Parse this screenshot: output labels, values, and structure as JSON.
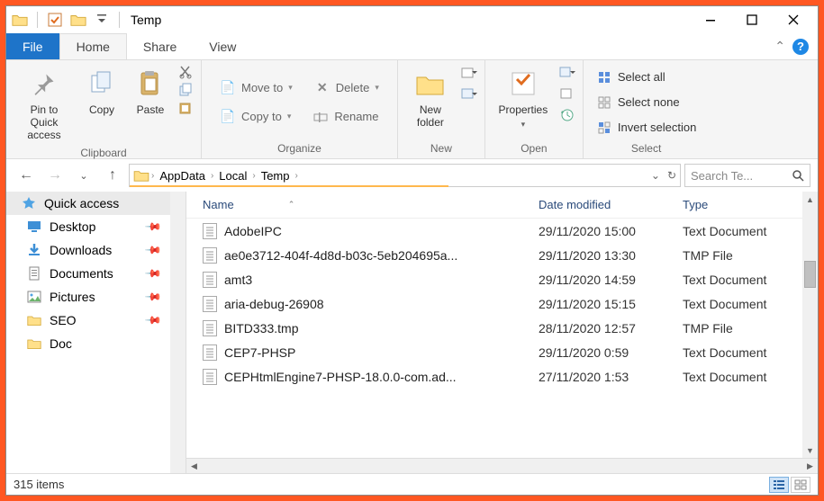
{
  "window": {
    "title": "Temp"
  },
  "tabs": {
    "file": "File",
    "home": "Home",
    "share": "Share",
    "view": "View"
  },
  "ribbon": {
    "clipboard": {
      "label": "Clipboard",
      "pin": "Pin to Quick access",
      "copy": "Copy",
      "paste": "Paste"
    },
    "organize": {
      "label": "Organize",
      "move_to": "Move to",
      "copy_to": "Copy to",
      "delete": "Delete",
      "rename": "Rename"
    },
    "new": {
      "label": "New",
      "new_folder": "New folder"
    },
    "open": {
      "label": "Open",
      "properties": "Properties"
    },
    "select": {
      "label": "Select",
      "select_all": "Select all",
      "select_none": "Select none",
      "invert": "Invert selection"
    }
  },
  "breadcrumb": {
    "items": [
      "AppData",
      "Local",
      "Temp"
    ]
  },
  "search": {
    "placeholder": "Search Te..."
  },
  "sidebar": {
    "header": "Quick access",
    "items": [
      {
        "label": "Desktop",
        "pinned": true
      },
      {
        "label": "Downloads",
        "pinned": true
      },
      {
        "label": "Documents",
        "pinned": true
      },
      {
        "label": "Pictures",
        "pinned": true
      },
      {
        "label": "SEO",
        "pinned": true
      },
      {
        "label": "Doc",
        "pinned": false
      }
    ]
  },
  "columns": {
    "name": "Name",
    "date": "Date modified",
    "type": "Type"
  },
  "files": [
    {
      "name": "AdobeIPC",
      "date": "29/11/2020 15:00",
      "type": "Text Document"
    },
    {
      "name": "ae0e3712-404f-4d8d-b03c-5eb204695a...",
      "date": "29/11/2020 13:30",
      "type": "TMP File"
    },
    {
      "name": "amt3",
      "date": "29/11/2020 14:59",
      "type": "Text Document"
    },
    {
      "name": "aria-debug-26908",
      "date": "29/11/2020 15:15",
      "type": "Text Document"
    },
    {
      "name": "BITD333.tmp",
      "date": "28/11/2020 12:57",
      "type": "TMP File"
    },
    {
      "name": "CEP7-PHSP",
      "date": "29/11/2020 0:59",
      "type": "Text Document"
    },
    {
      "name": "CEPHtmlEngine7-PHSP-18.0.0-com.ad...",
      "date": "27/11/2020 1:53",
      "type": "Text Document"
    }
  ],
  "status": {
    "items": "315 items"
  }
}
